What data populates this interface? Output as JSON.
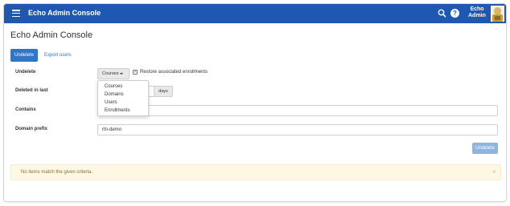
{
  "header": {
    "app_title": "Echo Admin Console",
    "user_line1": "Echo",
    "user_line2": "Admin",
    "help_glyph": "?",
    "brand_color": "#1f58b0",
    "icons": [
      "menu-icon",
      "search-icon",
      "help-icon",
      "avatar"
    ]
  },
  "page": {
    "title": "Echo Admin Console",
    "undelete_button": "Undelete",
    "export_link": "Export users"
  },
  "form": {
    "undelete_label": "Undelete",
    "type_selected": "Courses",
    "type_options": [
      "Courses",
      "Domains",
      "Users",
      "Enrollments"
    ],
    "restore_checked": true,
    "restore_checkbox_glyph": "✓",
    "restore_label": "Restore associated enrollments",
    "deleted_label": "Deleted in last",
    "deleted_value": "",
    "days_unit": "days",
    "contains_label": "Contains",
    "contains_value": "",
    "domain_prefix_label": "Domain prefix",
    "domain_prefix_value": "rtn-demo",
    "submit_label": "Undelete"
  },
  "alert": {
    "message": "No items match the given criteria.",
    "close_glyph": "×"
  }
}
